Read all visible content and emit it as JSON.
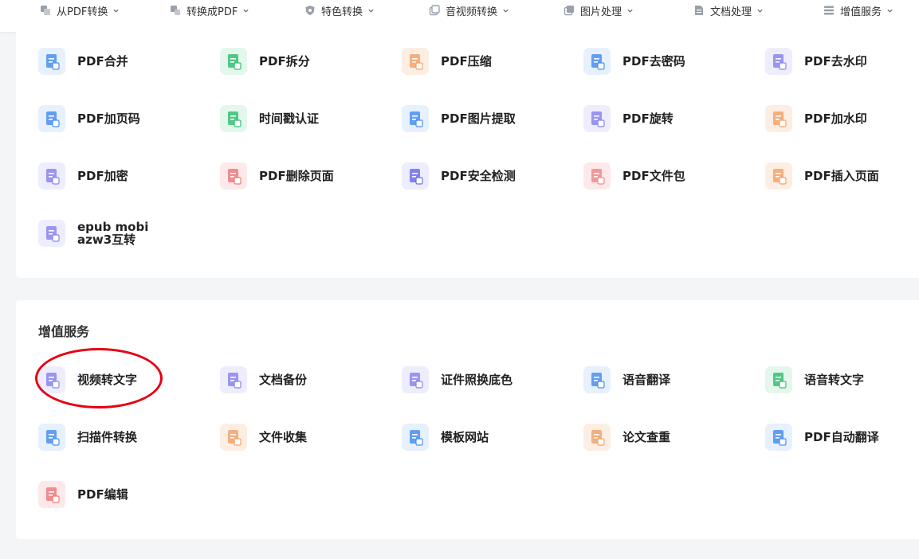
{
  "nav": {
    "items": [
      {
        "label": "从PDF转换",
        "icon": "pdf-convert-icon"
      },
      {
        "label": "转换成PDF",
        "icon": "to-pdf-icon"
      },
      {
        "label": "特色转换",
        "icon": "feature-shield-icon"
      },
      {
        "label": "音视频转换",
        "icon": "media-convert-icon"
      },
      {
        "label": "图片处理",
        "icon": "image-process-icon"
      },
      {
        "label": "文档处理",
        "icon": "document-process-icon"
      },
      {
        "label": "增值服务",
        "icon": "value-service-icon"
      }
    ]
  },
  "pdf_tools": {
    "items": [
      {
        "label": "PDF合并",
        "icon": "pdf-merge-icon",
        "color": "#4a8ff0",
        "bg": "#e7f0fd"
      },
      {
        "label": "PDF拆分",
        "icon": "pdf-split-icon",
        "color": "#36c174",
        "bg": "#e4f7ec"
      },
      {
        "label": "PDF压缩",
        "icon": "pdf-compress-icon",
        "color": "#f3a36b",
        "bg": "#fdeee3"
      },
      {
        "label": "PDF去密码",
        "icon": "pdf-remove-password-icon",
        "color": "#4a8ff0",
        "bg": "#e7f0fd"
      },
      {
        "label": "PDF去水印",
        "icon": "pdf-remove-watermark-icon",
        "color": "#8b84f0",
        "bg": "#eeedfd"
      },
      {
        "label": "PDF加页码",
        "icon": "pdf-page-number-icon",
        "color": "#4a8ff0",
        "bg": "#e7f0fd"
      },
      {
        "label": "时间戳认证",
        "icon": "timestamp-icon",
        "color": "#36c174",
        "bg": "#e4f7ec"
      },
      {
        "label": "PDF图片提取",
        "icon": "pdf-image-extract-icon",
        "color": "#4a8ff0",
        "bg": "#e7f0fd"
      },
      {
        "label": "PDF旋转",
        "icon": "pdf-rotate-icon",
        "color": "#8b84f0",
        "bg": "#eeedfd"
      },
      {
        "label": "PDF加水印",
        "icon": "pdf-add-watermark-icon",
        "color": "#f3a36b",
        "bg": "#fdeee3"
      },
      {
        "label": "PDF加密",
        "icon": "pdf-encrypt-icon",
        "color": "#8b84f0",
        "bg": "#eeedfd"
      },
      {
        "label": "PDF删除页面",
        "icon": "pdf-delete-page-icon",
        "color": "#f07a7a",
        "bg": "#fde9e9"
      },
      {
        "label": "PDF安全检测",
        "icon": "pdf-security-check-icon",
        "color": "#6d6ff0",
        "bg": "#eeedfd"
      },
      {
        "label": "PDF文件包",
        "icon": "pdf-portfolio-icon",
        "color": "#f08a8a",
        "bg": "#fde9e9"
      },
      {
        "label": "PDF插入页面",
        "icon": "pdf-insert-page-icon",
        "color": "#f3a36b",
        "bg": "#fdeee3"
      },
      {
        "label": "epub mobi azw3互转",
        "icon": "ebook-convert-icon",
        "color": "#8b84f0",
        "bg": "#eeedfd"
      }
    ]
  },
  "value_services": {
    "title": "增值服务",
    "items": [
      {
        "label": "视频转文字",
        "icon": "video-to-text-icon",
        "color": "#8b84f0",
        "bg": "#eeedfd"
      },
      {
        "label": "文档备份",
        "icon": "document-backup-icon",
        "color": "#8b84f0",
        "bg": "#eeedfd"
      },
      {
        "label": "证件照换底色",
        "icon": "id-photo-icon",
        "color": "#8b84f0",
        "bg": "#eeedfd"
      },
      {
        "label": "语音翻译",
        "icon": "voice-translate-icon",
        "color": "#4a8ff0",
        "bg": "#e7f0fd"
      },
      {
        "label": "语音转文字",
        "icon": "voice-to-text-icon",
        "color": "#36c174",
        "bg": "#e4f7ec"
      },
      {
        "label": "扫描件转换",
        "icon": "scan-convert-icon",
        "color": "#4a8ff0",
        "bg": "#e7f0fd"
      },
      {
        "label": "文件收集",
        "icon": "file-collect-icon",
        "color": "#f3a36b",
        "bg": "#fdeee3"
      },
      {
        "label": "模板网站",
        "icon": "template-cloud-icon",
        "color": "#4a8ff0",
        "bg": "#e7f0fd"
      },
      {
        "label": "论文查重",
        "icon": "paper-check-icon",
        "color": "#f3a36b",
        "bg": "#fdeee3"
      },
      {
        "label": "PDF自动翻译",
        "icon": "pdf-auto-translate-icon",
        "color": "#4a8ff0",
        "bg": "#e7f0fd"
      },
      {
        "label": "PDF编辑",
        "icon": "pdf-edit-icon",
        "color": "#f07a7a",
        "bg": "#fde9e9"
      }
    ]
  },
  "annotation": {
    "color": "#e60012"
  }
}
